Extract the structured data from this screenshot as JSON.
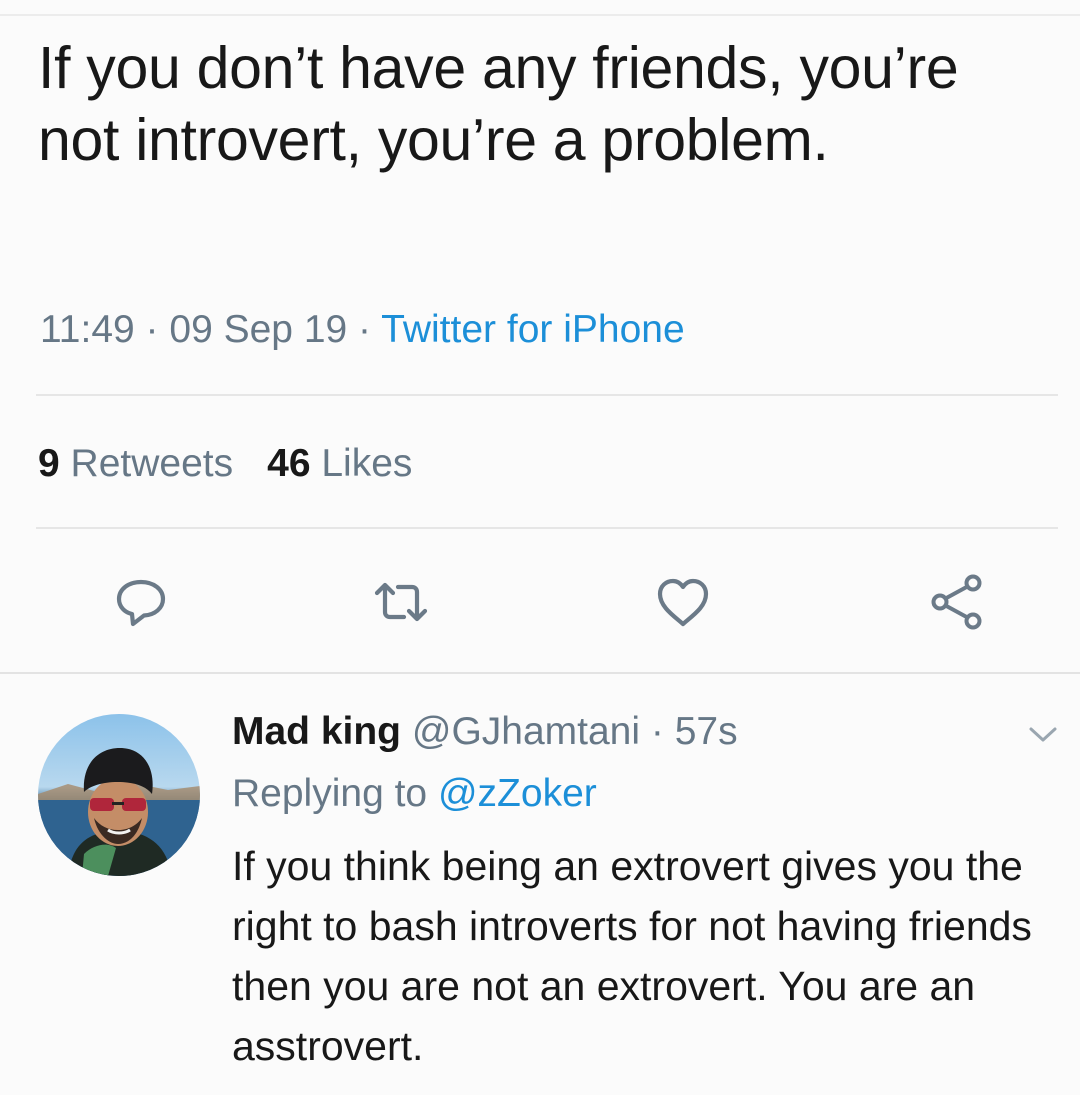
{
  "tweet": {
    "text": "If you don’t have any friends, you’re not introvert, you’re a problem.",
    "time": "11:49",
    "separator": " · ",
    "date": "09 Sep 19",
    "source": "Twitter for iPhone",
    "retweets_count": "9",
    "retweets_label": "Retweets",
    "likes_count": "46",
    "likes_label": "Likes"
  },
  "actions": {
    "reply_icon": "reply-icon",
    "retweet_icon": "retweet-icon",
    "like_icon": "heart-icon",
    "share_icon": "share-icon"
  },
  "reply": {
    "name": "Mad king",
    "handle": "@GJhamtani",
    "separator": " · ",
    "age": "57s",
    "replying_prefix": "Replying to",
    "replying_handle": "@zZoker",
    "text": "If you think being an extrovert gives you the right to bash introverts for not having friends then you are not an extrovert. You are an asstrovert."
  },
  "colors": {
    "link": "#1c8fd8",
    "meta_gray": "#667786",
    "text": "#181818",
    "icon_gray": "#6b7a88"
  }
}
